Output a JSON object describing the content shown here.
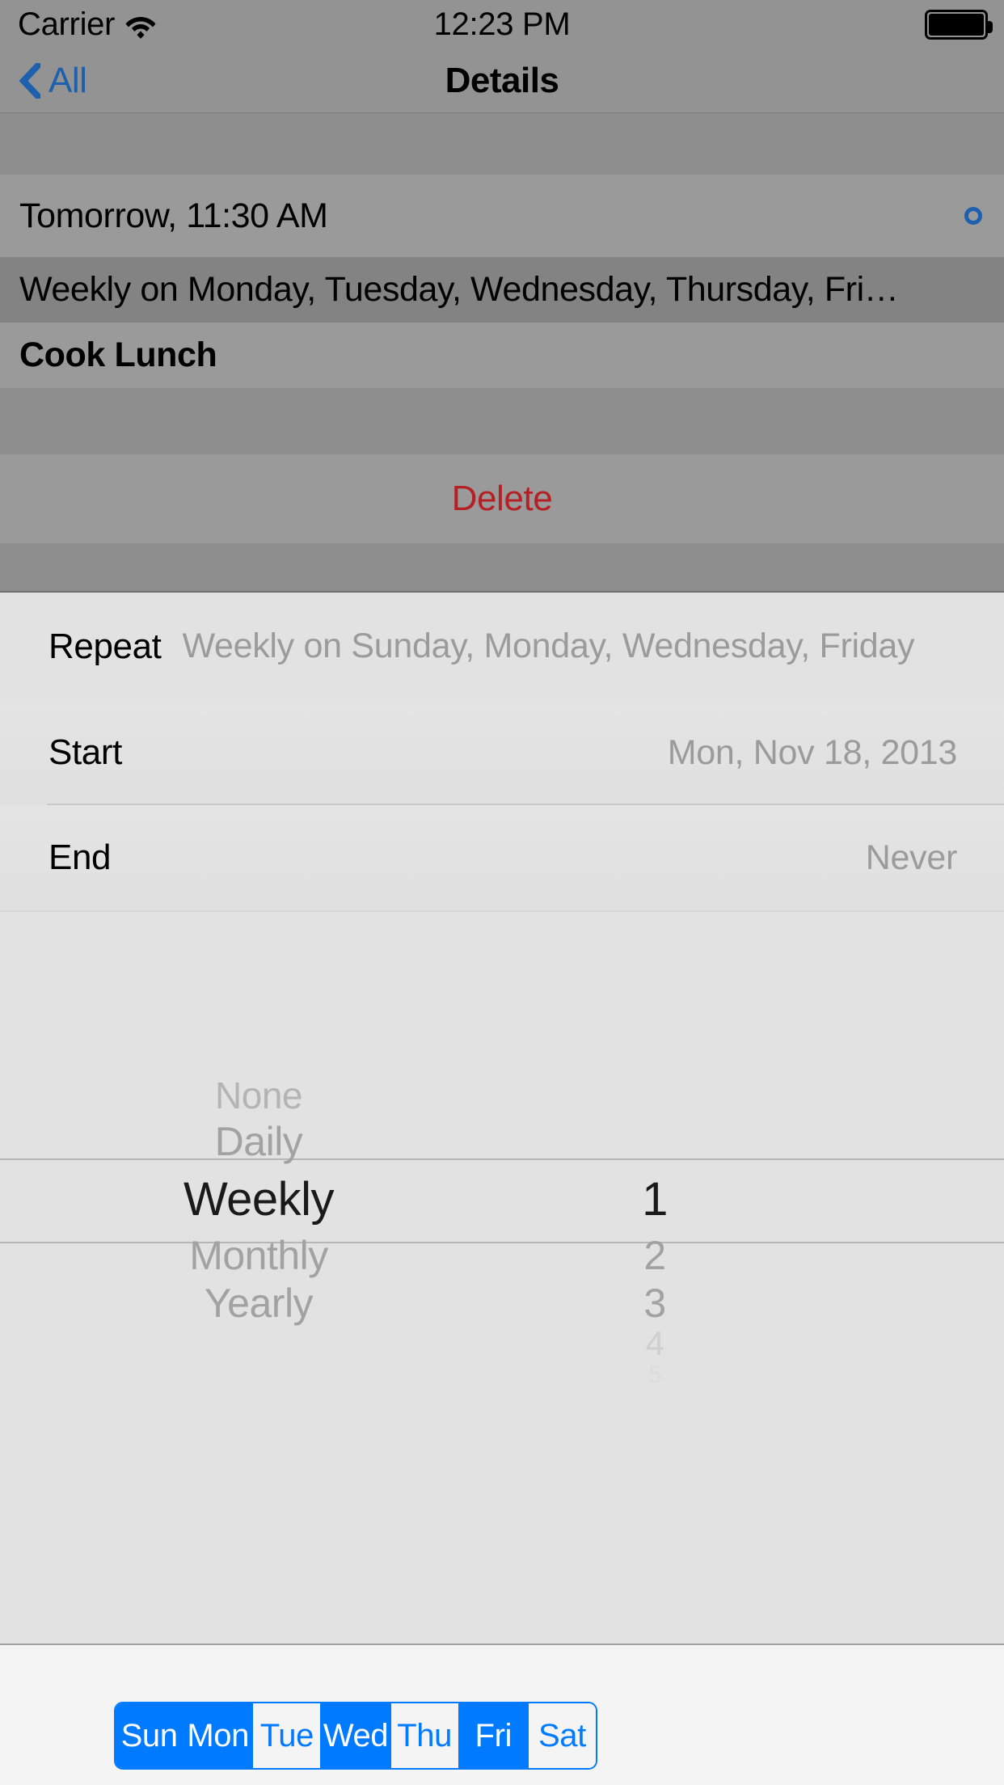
{
  "status_bar": {
    "carrier": "Carrier",
    "wifi_icon": "wifi-icon",
    "time": "12:23 PM",
    "battery_icon": "battery-full-icon"
  },
  "nav_bar": {
    "back_icon": "chevron-left-icon",
    "back_label": "All",
    "title": "Details"
  },
  "detail_list": {
    "rows": [
      {
        "text": "Tomorrow, 11:30 AM",
        "bold": false,
        "selected": false,
        "accessory": "circle-outline-icon"
      },
      {
        "text": "Weekly on Monday, Tuesday, Wednesday, Thursday, Fri…",
        "bold": false,
        "selected": true,
        "accessory": ""
      },
      {
        "text": "Cook Lunch",
        "bold": true,
        "selected": false,
        "accessory": ""
      }
    ],
    "delete_label": "Delete"
  },
  "repeat_panel": {
    "fields": [
      {
        "label": "Repeat",
        "value": "Weekly on Sunday, Monday, Wednesday, Friday"
      },
      {
        "label": "Start",
        "value": "Mon, Nov 18, 2013"
      },
      {
        "label": "End",
        "value": "Never"
      }
    ],
    "picker": {
      "frequency": {
        "items": [
          "None",
          "Daily",
          "Weekly",
          "Monthly",
          "Yearly"
        ],
        "selected": "Weekly"
      },
      "interval": {
        "items": [
          "1",
          "2",
          "3",
          "4",
          "5"
        ],
        "selected": "1"
      }
    },
    "day_selector": {
      "days": [
        {
          "label": "Sun",
          "selected": true
        },
        {
          "label": "Mon",
          "selected": true
        },
        {
          "label": "Tue",
          "selected": false
        },
        {
          "label": "Wed",
          "selected": true
        },
        {
          "label": "Thu",
          "selected": false
        },
        {
          "label": "Fri",
          "selected": true
        },
        {
          "label": "Sat",
          "selected": false
        }
      ]
    }
  },
  "colors": {
    "tint_blue": "#007aff",
    "nav_blue": "#1c60ae",
    "destructive_red": "#b62025",
    "dimmed_bg": "#8e8e8e",
    "panel_bg": "#e2e2e2"
  }
}
